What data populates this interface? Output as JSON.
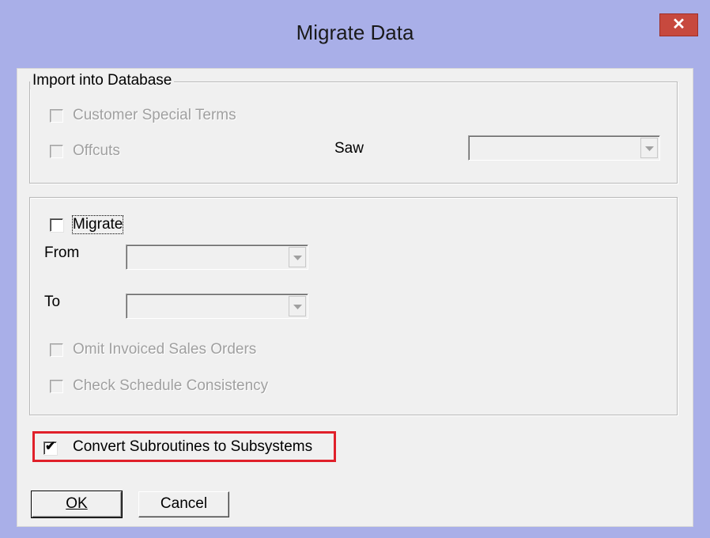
{
  "window": {
    "title": "Migrate Data",
    "close_glyph": "✕"
  },
  "import_group": {
    "legend": "Import into Database",
    "customer_special_terms": {
      "label": "Customer Special Terms",
      "checked": false,
      "enabled": false
    },
    "offcuts": {
      "label": "Offcuts",
      "checked": false,
      "enabled": false
    },
    "saw_label": "Saw",
    "saw_value": ""
  },
  "migrate_group": {
    "migrate": {
      "label": "Migrate",
      "checked": false,
      "enabled": true
    },
    "from_label": "From",
    "from_value": "",
    "to_label": "To",
    "to_value": "",
    "omit_invoiced": {
      "label": "Omit Invoiced Sales Orders",
      "checked": false,
      "enabled": false
    },
    "check_schedule": {
      "label": "Check Schedule Consistency",
      "checked": false,
      "enabled": false
    }
  },
  "convert_subroutines": {
    "label": "Convert Subroutines to Subsystems",
    "checked": true,
    "check_glyph": "✔",
    "highlight_color": "#e0202a"
  },
  "buttons": {
    "ok": "OK",
    "cancel": "Cancel"
  },
  "colors": {
    "title_bar": "#a9afe8",
    "close_button": "#c7493e",
    "dialog_face": "#f0f0f0",
    "disabled_text": "#a0a0a0"
  }
}
